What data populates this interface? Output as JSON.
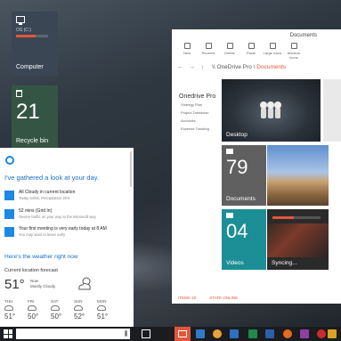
{
  "desktop": {
    "computer_tile": {
      "label": "Computer",
      "subtitle": "OS (C:)",
      "usage_fraction": 0.62
    },
    "recycle_tile": {
      "count": "21",
      "label": "Recycle bin"
    }
  },
  "cortana": {
    "greeting": "I've gathered a look at your day.",
    "cards": [
      {
        "title": "All Cloudy in current location",
        "sub": "Today 64/55, Precipitation 20%"
      },
      {
        "title": "52 mins (Grid In)",
        "sub": "Severe traffic on your way to the Microsoft way"
      },
      {
        "title": "Your first meeting is very early today at 8 AM",
        "sub": "You may want to leave early"
      }
    ],
    "weather_link": "Here's the weather right now",
    "forecast_label": "Current location forecast",
    "temp": "51°",
    "condition_line1": "Now",
    "condition_line2": "Mostly Cloudy",
    "days": [
      {
        "name": "THU",
        "temp": "51°"
      },
      {
        "name": "FRI",
        "temp": "50°"
      },
      {
        "name": "SAT",
        "temp": "50°"
      },
      {
        "name": "SUN",
        "temp": "52°"
      },
      {
        "name": "MON",
        "temp": "51°"
      }
    ]
  },
  "explorer": {
    "title": "Documents",
    "ribbon": [
      "New",
      "Recents",
      "Delete",
      "Paste",
      "Large icons",
      "Medium icons"
    ],
    "crumb_root": "\\\\ OneDrive Pro",
    "crumb_sep": "\\",
    "crumb_current": "Documents",
    "sidebar_root": "Onedrive Pro",
    "sidebar_children": [
      "Strategy Plan",
      "Project Takedown",
      "Accounts",
      "Expense Tracking"
    ],
    "tiles": {
      "desktop": "Desktop",
      "documents_count": "79",
      "documents": "Documents",
      "videos_count": "04",
      "videos": "Videos",
      "syncing": "Syncing...",
      "sync_progress": 0.45
    },
    "status": [
      "ITEMS 18",
      "STATE ONLINE"
    ]
  },
  "colors": {
    "accent": "#e4563c",
    "cortana_blue": "#1a6fc4",
    "videos_teal": "#1b8e96"
  },
  "taskbar": {
    "icons": [
      {
        "name": "task-view-icon",
        "color": "#ffffff"
      },
      {
        "name": "file-explorer-icon",
        "color": "#e4563c"
      },
      {
        "name": "store-icon",
        "color": "#2f7ac9"
      },
      {
        "name": "chrome-icon",
        "color": "#e8a33a"
      },
      {
        "name": "outlook-icon",
        "color": "#2f6fbf"
      },
      {
        "name": "excel-icon",
        "color": "#1f8a4c"
      },
      {
        "name": "word-icon",
        "color": "#2b5faa"
      },
      {
        "name": "firefox-icon",
        "color": "#e66a1f"
      },
      {
        "name": "onenote-icon",
        "color": "#8e3fa3"
      },
      {
        "name": "opera-icon",
        "color": "#cc2b2b"
      },
      {
        "name": "app-icon",
        "color": "#d9a41f"
      }
    ]
  }
}
